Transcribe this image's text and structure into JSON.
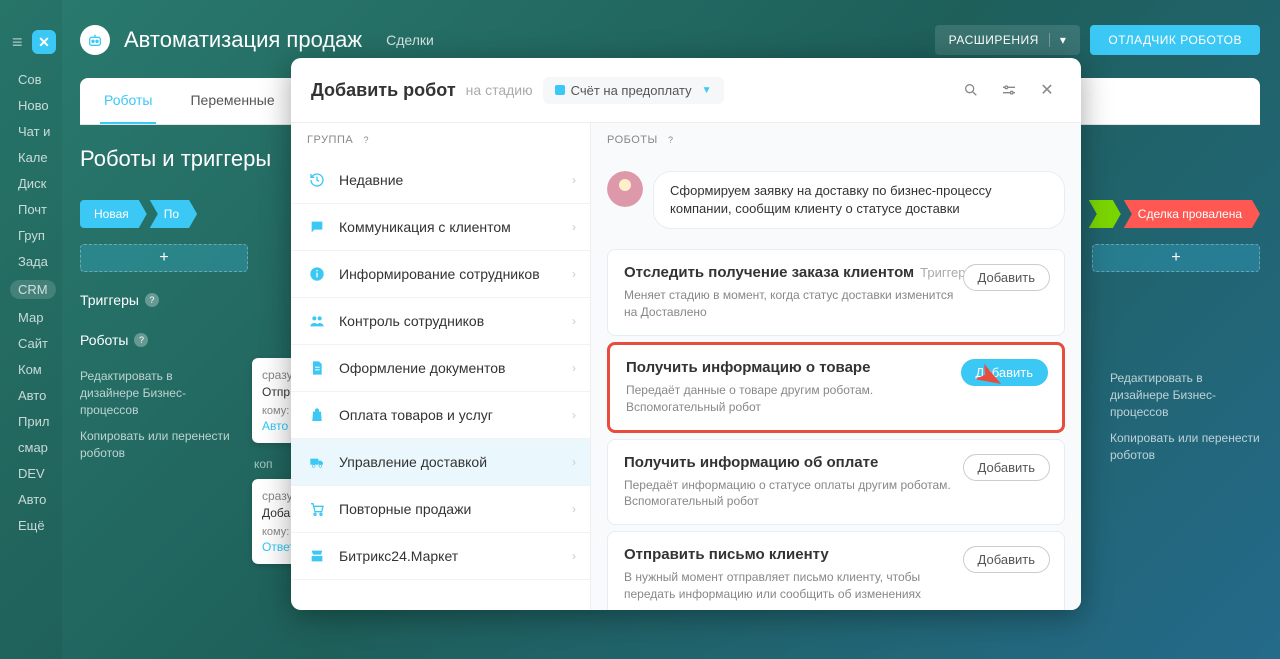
{
  "header": {
    "title": "Автоматизация продаж",
    "breadcrumb": "Сделки",
    "ext_btn": "РАСШИРЕНИЯ",
    "debug_btn": "ОТЛАДЧИК РОБОТОВ"
  },
  "nav": [
    "Сов",
    "Ново",
    "Чат и",
    "Кале",
    "Диск",
    "Почт",
    "Груп",
    "Зада",
    "CRM",
    "Мар",
    "Сайт",
    "Ком",
    "Авто",
    "Прил",
    "смар",
    "DEV",
    "Авто",
    "Ещё"
  ],
  "tabs": {
    "robots": "Роботы",
    "vars": "Переменные"
  },
  "section_title": "Роботы и триггеры",
  "stages": {
    "left": [
      "Новая",
      "По"
    ],
    "won": "",
    "lost": "Сделка провалена",
    "add": "+"
  },
  "left_panel": {
    "triggers": "Триггеры",
    "robots": "Роботы",
    "link1": "Редактировать в дизайнере Бизнес-процессов",
    "link2": "Копировать или перенести роботов"
  },
  "bg_cards": [
    {
      "l1": "сразу",
      "l2": "Отпр",
      "l3": "кому:",
      "l4": "Авто"
    },
    {
      "l3b": "коп"
    },
    {
      "l1": "сразу",
      "l2": "Доба",
      "l3": "кому:",
      "l4": "Ответственным мен..."
    }
  ],
  "modal": {
    "title": "Добавить робот",
    "sub": "на стадию",
    "stage": "Счёт на предоплату",
    "col_group": "ГРУППА",
    "col_robots": "РОБОТЫ",
    "groups": [
      {
        "icon": "history",
        "label": "Недавние"
      },
      {
        "icon": "chat",
        "label": "Коммуникация с клиентом"
      },
      {
        "icon": "info",
        "label": "Информирование сотрудников"
      },
      {
        "icon": "people",
        "label": "Контроль сотрудников"
      },
      {
        "icon": "doc",
        "label": "Оформление документов"
      },
      {
        "icon": "bag",
        "label": "Оплата товаров и услуг"
      },
      {
        "icon": "truck",
        "label": "Управление доставкой",
        "selected": true
      },
      {
        "icon": "cart",
        "label": "Повторные продажи"
      },
      {
        "icon": "market",
        "label": "Битрикс24.Маркет"
      }
    ],
    "assist": "Сформируем заявку на доставку по бизнес-процессу компании, сообщим клиенту о статусе доставки",
    "robots": [
      {
        "title": "Отследить получение заказа клиентом",
        "tag": "Триггер",
        "desc": "Меняет стадию в момент, когда статус доставки изменится на Доставлено",
        "primary": false
      },
      {
        "title": "Получить информацию о товаре",
        "desc": "Передаёт данные о товаре другим роботам. Вспомогательный робот",
        "primary": true,
        "highlight": true
      },
      {
        "title": "Получить информацию об оплате",
        "desc": "Передаёт информацию о статусе оплаты другим роботам. Вспомогательный робот",
        "primary": false
      },
      {
        "title": "Отправить письмо клиенту",
        "desc": "В нужный момент отправляет письмо клиенту, чтобы передать информацию или сообщить об изменениях",
        "primary": false
      }
    ],
    "add_btn": "Добавить"
  }
}
